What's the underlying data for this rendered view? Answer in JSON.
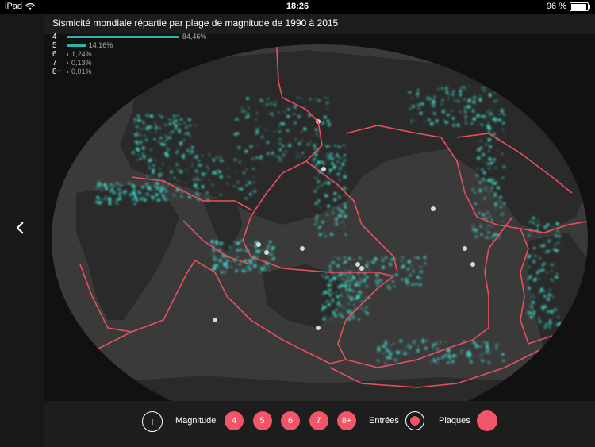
{
  "status": {
    "device": "iPad",
    "time": "18:26",
    "battery": "96 %"
  },
  "title": "Sismicité mondiale répartie par plage de magnitude de 1990 à 2015",
  "legend": [
    {
      "mag": "4",
      "pct": "84,46%",
      "share": 0.8446
    },
    {
      "mag": "5",
      "pct": "14,16%",
      "share": 0.1416
    },
    {
      "mag": "6",
      "pct": "1,24%",
      "share": 0.0124
    },
    {
      "mag": "7",
      "pct": "0,13%",
      "share": 0.0013
    },
    {
      "mag": "8+",
      "pct": "0,01%",
      "share": 0.0001
    }
  ],
  "controls": {
    "plus": "+",
    "magnitude_label": "Magnitude",
    "magnitudes": [
      "4",
      "5",
      "6",
      "7",
      "8+"
    ],
    "entries_label": "Entrées",
    "plates_label": "Plaques"
  },
  "colors": {
    "accent": "#f25567",
    "quake": "#3fe0d0",
    "land": "#2c2c2c",
    "ocean": "#3a3a3a",
    "plates": "#e8505f"
  },
  "icons": {
    "back": "chevron-left-icon",
    "wifi": "wifi-icon",
    "battery": "battery-icon"
  }
}
